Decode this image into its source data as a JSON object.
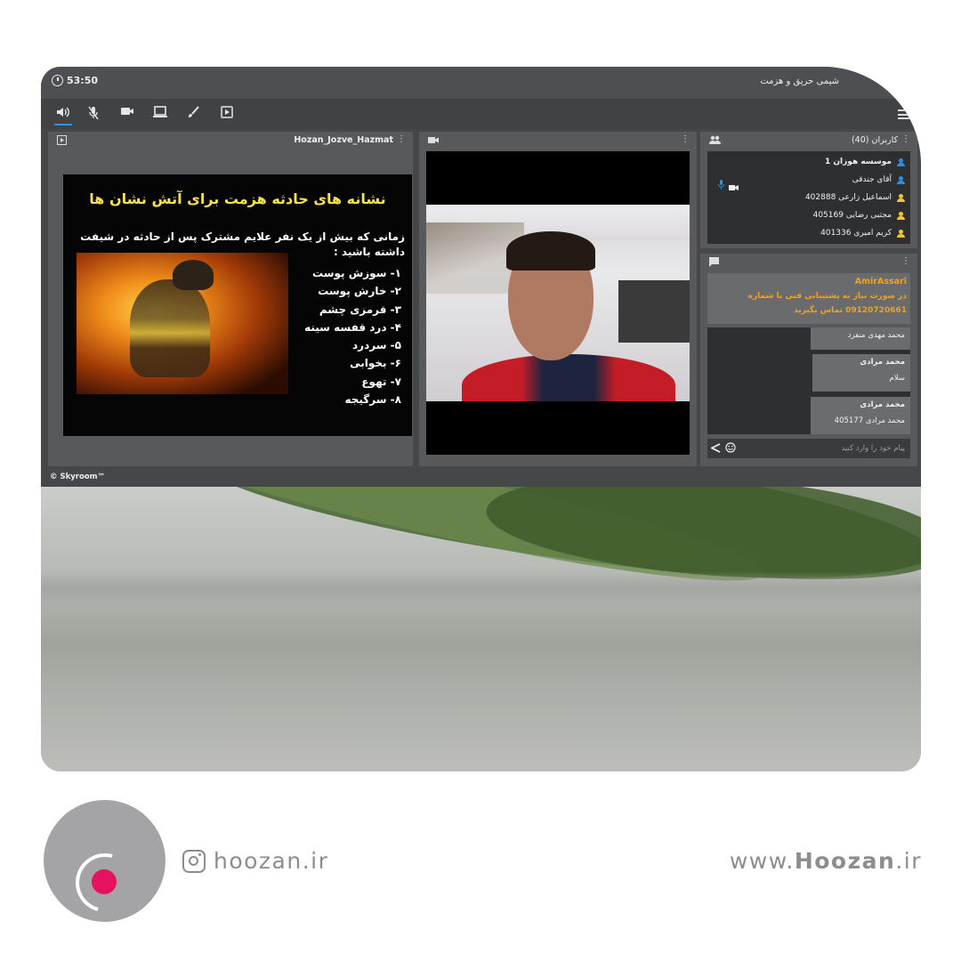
{
  "window": {
    "timer": "53:50",
    "title": "شیمی حریق و هزمت",
    "footer_brand": "© Skyroom™"
  },
  "toolbar": {
    "icons": [
      "speaker-icon",
      "mic-muted-icon",
      "camera-icon",
      "screen-share-icon",
      "brush-icon",
      "play-media-icon",
      "menu-icon"
    ]
  },
  "presentation": {
    "header": "Hozan_Jozve_Hazmat",
    "slide_title": "نشانه های حادثه هزمت برای آتش نشان ها",
    "slide_intro": "زمانی که  بیش از یک نفر علایم مشترک پس از حادثه در شیفت داشته باشید :",
    "symptoms": [
      "۱- سوزش پوست",
      "۲- خارش پوست",
      "۳- قرمزی چشم",
      "۴- درد قفسه سینه",
      "۵- سردرد",
      "۶- بخوابی",
      "۷- تهوع",
      "۸- سرگیجه"
    ]
  },
  "users": {
    "header": "کاربران (40)",
    "list": [
      {
        "name": "موسسه هوزان 1",
        "color": "#2f8fe0"
      },
      {
        "name": "آقای جندقی",
        "color": "#2f8fe0"
      },
      {
        "name": "اسماعیل زارعی 402888",
        "color": "#f2c530"
      },
      {
        "name": "مجتبی رضایی 405169",
        "color": "#f2c530"
      },
      {
        "name": "کریم امیری 401336",
        "color": "#f2c530"
      }
    ]
  },
  "chat": {
    "pinned_author": "AmirAssari",
    "pinned_line1": "در صورت نیاز به پشتیبانی فنی با شماره",
    "pinned_line2": "09120720661 تماس بگیرید",
    "accent": "#f0a21f",
    "messages": [
      {
        "author": "محمد مهدی منفرد",
        "text": ""
      },
      {
        "author": "محمد مرادی",
        "text": "سلام"
      },
      {
        "author": "محمد مرادی",
        "text": "محمد مرادی 405177"
      }
    ],
    "input_placeholder": "پیام خود را وارد کنید"
  },
  "branding": {
    "instagram": "hoozan.ir",
    "website_prefix": "www.",
    "website_bold": "Hoozan",
    "website_suffix": ".ir",
    "accent": "#e5135f"
  }
}
